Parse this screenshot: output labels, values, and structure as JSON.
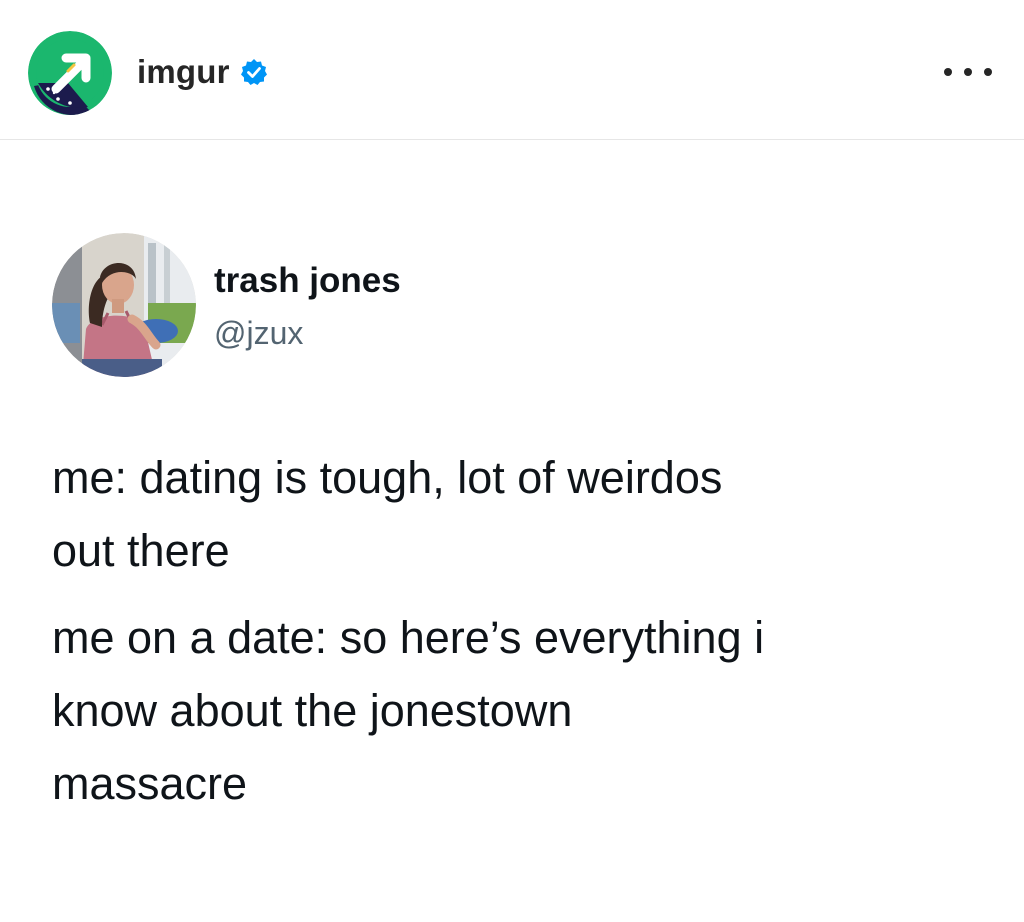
{
  "post": {
    "account_name": "imgur",
    "account_avatar_icon": "imgur-logo-icon",
    "verified_icon": "verified-badge-icon",
    "more_icon": "more-options-icon",
    "brand_color": "#1bb76e",
    "verified_color": "#0095f6"
  },
  "tweet": {
    "display_name": "trash jones",
    "handle": "@jzux",
    "avatar_icon": "profile-photo",
    "paragraphs": [
      "me: dating is tough, lot of weirdos\nout there",
      "me on a date: so here’s everything i\nknow about the jonestown\nmassacre"
    ]
  }
}
